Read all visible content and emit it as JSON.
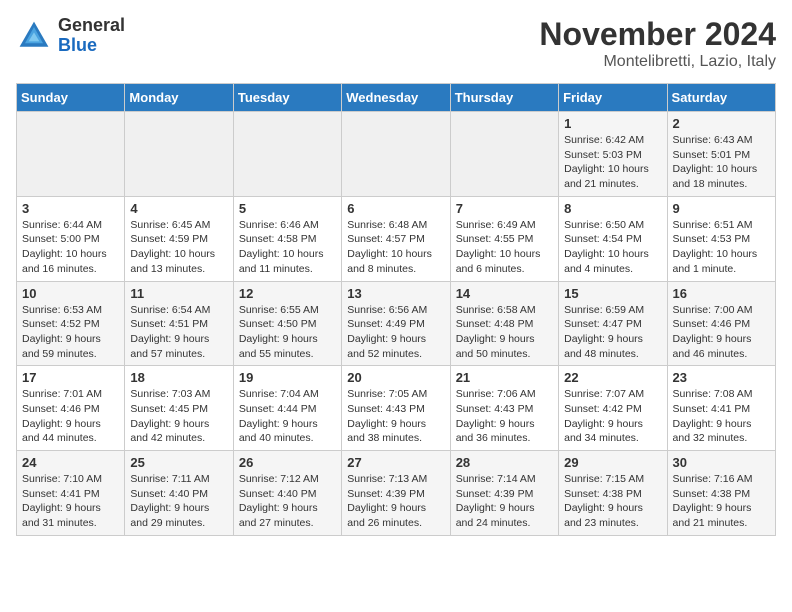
{
  "header": {
    "logo_line1": "General",
    "logo_line2": "Blue",
    "month_title": "November 2024",
    "location": "Montelibretti, Lazio, Italy"
  },
  "days_of_week": [
    "Sunday",
    "Monday",
    "Tuesday",
    "Wednesday",
    "Thursday",
    "Friday",
    "Saturday"
  ],
  "weeks": [
    [
      {
        "day": "",
        "info": ""
      },
      {
        "day": "",
        "info": ""
      },
      {
        "day": "",
        "info": ""
      },
      {
        "day": "",
        "info": ""
      },
      {
        "day": "",
        "info": ""
      },
      {
        "day": "1",
        "info": "Sunrise: 6:42 AM\nSunset: 5:03 PM\nDaylight: 10 hours and 21 minutes."
      },
      {
        "day": "2",
        "info": "Sunrise: 6:43 AM\nSunset: 5:01 PM\nDaylight: 10 hours and 18 minutes."
      }
    ],
    [
      {
        "day": "3",
        "info": "Sunrise: 6:44 AM\nSunset: 5:00 PM\nDaylight: 10 hours and 16 minutes."
      },
      {
        "day": "4",
        "info": "Sunrise: 6:45 AM\nSunset: 4:59 PM\nDaylight: 10 hours and 13 minutes."
      },
      {
        "day": "5",
        "info": "Sunrise: 6:46 AM\nSunset: 4:58 PM\nDaylight: 10 hours and 11 minutes."
      },
      {
        "day": "6",
        "info": "Sunrise: 6:48 AM\nSunset: 4:57 PM\nDaylight: 10 hours and 8 minutes."
      },
      {
        "day": "7",
        "info": "Sunrise: 6:49 AM\nSunset: 4:55 PM\nDaylight: 10 hours and 6 minutes."
      },
      {
        "day": "8",
        "info": "Sunrise: 6:50 AM\nSunset: 4:54 PM\nDaylight: 10 hours and 4 minutes."
      },
      {
        "day": "9",
        "info": "Sunrise: 6:51 AM\nSunset: 4:53 PM\nDaylight: 10 hours and 1 minute."
      }
    ],
    [
      {
        "day": "10",
        "info": "Sunrise: 6:53 AM\nSunset: 4:52 PM\nDaylight: 9 hours and 59 minutes."
      },
      {
        "day": "11",
        "info": "Sunrise: 6:54 AM\nSunset: 4:51 PM\nDaylight: 9 hours and 57 minutes."
      },
      {
        "day": "12",
        "info": "Sunrise: 6:55 AM\nSunset: 4:50 PM\nDaylight: 9 hours and 55 minutes."
      },
      {
        "day": "13",
        "info": "Sunrise: 6:56 AM\nSunset: 4:49 PM\nDaylight: 9 hours and 52 minutes."
      },
      {
        "day": "14",
        "info": "Sunrise: 6:58 AM\nSunset: 4:48 PM\nDaylight: 9 hours and 50 minutes."
      },
      {
        "day": "15",
        "info": "Sunrise: 6:59 AM\nSunset: 4:47 PM\nDaylight: 9 hours and 48 minutes."
      },
      {
        "day": "16",
        "info": "Sunrise: 7:00 AM\nSunset: 4:46 PM\nDaylight: 9 hours and 46 minutes."
      }
    ],
    [
      {
        "day": "17",
        "info": "Sunrise: 7:01 AM\nSunset: 4:46 PM\nDaylight: 9 hours and 44 minutes."
      },
      {
        "day": "18",
        "info": "Sunrise: 7:03 AM\nSunset: 4:45 PM\nDaylight: 9 hours and 42 minutes."
      },
      {
        "day": "19",
        "info": "Sunrise: 7:04 AM\nSunset: 4:44 PM\nDaylight: 9 hours and 40 minutes."
      },
      {
        "day": "20",
        "info": "Sunrise: 7:05 AM\nSunset: 4:43 PM\nDaylight: 9 hours and 38 minutes."
      },
      {
        "day": "21",
        "info": "Sunrise: 7:06 AM\nSunset: 4:43 PM\nDaylight: 9 hours and 36 minutes."
      },
      {
        "day": "22",
        "info": "Sunrise: 7:07 AM\nSunset: 4:42 PM\nDaylight: 9 hours and 34 minutes."
      },
      {
        "day": "23",
        "info": "Sunrise: 7:08 AM\nSunset: 4:41 PM\nDaylight: 9 hours and 32 minutes."
      }
    ],
    [
      {
        "day": "24",
        "info": "Sunrise: 7:10 AM\nSunset: 4:41 PM\nDaylight: 9 hours and 31 minutes."
      },
      {
        "day": "25",
        "info": "Sunrise: 7:11 AM\nSunset: 4:40 PM\nDaylight: 9 hours and 29 minutes."
      },
      {
        "day": "26",
        "info": "Sunrise: 7:12 AM\nSunset: 4:40 PM\nDaylight: 9 hours and 27 minutes."
      },
      {
        "day": "27",
        "info": "Sunrise: 7:13 AM\nSunset: 4:39 PM\nDaylight: 9 hours and 26 minutes."
      },
      {
        "day": "28",
        "info": "Sunrise: 7:14 AM\nSunset: 4:39 PM\nDaylight: 9 hours and 24 minutes."
      },
      {
        "day": "29",
        "info": "Sunrise: 7:15 AM\nSunset: 4:38 PM\nDaylight: 9 hours and 23 minutes."
      },
      {
        "day": "30",
        "info": "Sunrise: 7:16 AM\nSunset: 4:38 PM\nDaylight: 9 hours and 21 minutes."
      }
    ]
  ]
}
